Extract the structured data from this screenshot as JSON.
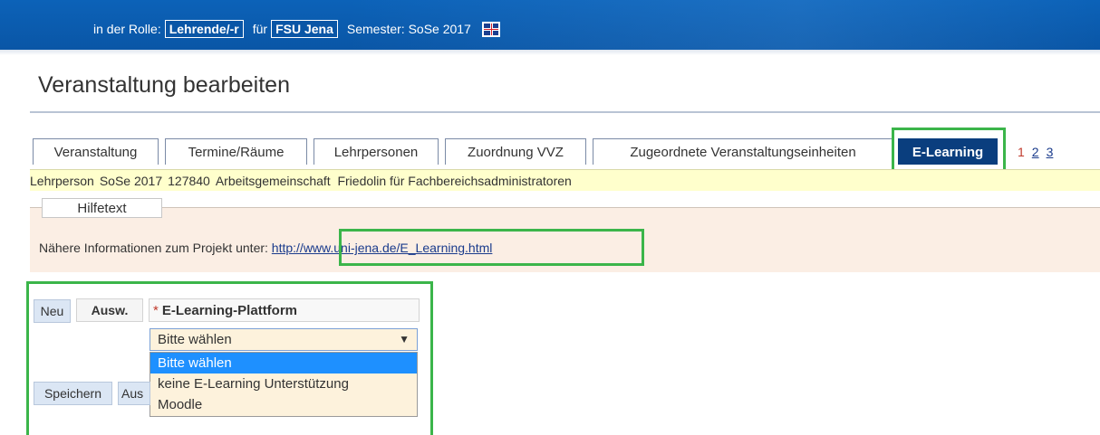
{
  "topbar": {
    "role_label": "in der Rolle:",
    "role_value": "Lehrende/-r",
    "for_label": "für",
    "institution": "FSU Jena",
    "semester_text": "Semester: SoSe 2017",
    "language_flag_icon": "uk-flag-icon"
  },
  "page": {
    "title": "Veranstaltung bearbeiten"
  },
  "tabs": [
    {
      "label": "Veranstaltung"
    },
    {
      "label": "Termine/Räume"
    },
    {
      "label": "Lehrpersonen"
    },
    {
      "label": "Zuordnung VVZ"
    },
    {
      "label": "Zugeordnete Veranstaltungseinheiten"
    },
    {
      "label": "E-Learning",
      "active": true
    }
  ],
  "pagination": {
    "current": "1",
    "links": [
      "2",
      "3"
    ]
  },
  "info_row": {
    "role": "Lehrperson",
    "semester": "SoSe 2017",
    "number": "127840",
    "title": "Arbeitsgemeinschaft  Friedolin für Fachbereichsadministratoren"
  },
  "help": {
    "legend": "Hilfetext",
    "text": "Nähere Informationen zum Projekt unter: ",
    "link": "http://www.uni-jena.de/E_Learning.html"
  },
  "form": {
    "new_button": "Neu",
    "select_column": "Ausw.",
    "required_marker": "*",
    "field_label": "E-Learning-Plattform",
    "select_value": "Bitte wählen",
    "options": [
      "Bitte wählen",
      "keine E-Learning Unterstützung",
      "Moodle"
    ],
    "save_button": "Speichern",
    "second_button": "Aus"
  },
  "colors": {
    "topbar": "#0a56a6",
    "active_tab": "#0a3e7e",
    "highlight": "#3bb54a",
    "info_row": "#ffffcc",
    "help_panel": "#fbeee4",
    "selected_option": "#1e90ff"
  }
}
